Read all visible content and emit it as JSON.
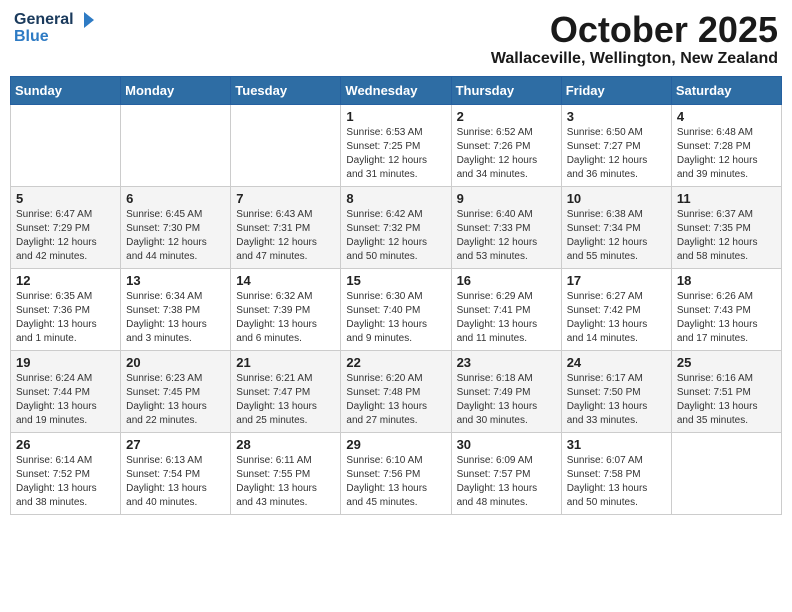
{
  "header": {
    "logo_line1": "General",
    "logo_line2": "Blue",
    "month": "October 2025",
    "location": "Wallaceville, Wellington, New Zealand"
  },
  "weekdays": [
    "Sunday",
    "Monday",
    "Tuesday",
    "Wednesday",
    "Thursday",
    "Friday",
    "Saturday"
  ],
  "weeks": [
    [
      {
        "day": "",
        "info": ""
      },
      {
        "day": "",
        "info": ""
      },
      {
        "day": "",
        "info": ""
      },
      {
        "day": "1",
        "info": "Sunrise: 6:53 AM\nSunset: 7:25 PM\nDaylight: 12 hours\nand 31 minutes."
      },
      {
        "day": "2",
        "info": "Sunrise: 6:52 AM\nSunset: 7:26 PM\nDaylight: 12 hours\nand 34 minutes."
      },
      {
        "day": "3",
        "info": "Sunrise: 6:50 AM\nSunset: 7:27 PM\nDaylight: 12 hours\nand 36 minutes."
      },
      {
        "day": "4",
        "info": "Sunrise: 6:48 AM\nSunset: 7:28 PM\nDaylight: 12 hours\nand 39 minutes."
      }
    ],
    [
      {
        "day": "5",
        "info": "Sunrise: 6:47 AM\nSunset: 7:29 PM\nDaylight: 12 hours\nand 42 minutes."
      },
      {
        "day": "6",
        "info": "Sunrise: 6:45 AM\nSunset: 7:30 PM\nDaylight: 12 hours\nand 44 minutes."
      },
      {
        "day": "7",
        "info": "Sunrise: 6:43 AM\nSunset: 7:31 PM\nDaylight: 12 hours\nand 47 minutes."
      },
      {
        "day": "8",
        "info": "Sunrise: 6:42 AM\nSunset: 7:32 PM\nDaylight: 12 hours\nand 50 minutes."
      },
      {
        "day": "9",
        "info": "Sunrise: 6:40 AM\nSunset: 7:33 PM\nDaylight: 12 hours\nand 53 minutes."
      },
      {
        "day": "10",
        "info": "Sunrise: 6:38 AM\nSunset: 7:34 PM\nDaylight: 12 hours\nand 55 minutes."
      },
      {
        "day": "11",
        "info": "Sunrise: 6:37 AM\nSunset: 7:35 PM\nDaylight: 12 hours\nand 58 minutes."
      }
    ],
    [
      {
        "day": "12",
        "info": "Sunrise: 6:35 AM\nSunset: 7:36 PM\nDaylight: 13 hours\nand 1 minute."
      },
      {
        "day": "13",
        "info": "Sunrise: 6:34 AM\nSunset: 7:38 PM\nDaylight: 13 hours\nand 3 minutes."
      },
      {
        "day": "14",
        "info": "Sunrise: 6:32 AM\nSunset: 7:39 PM\nDaylight: 13 hours\nand 6 minutes."
      },
      {
        "day": "15",
        "info": "Sunrise: 6:30 AM\nSunset: 7:40 PM\nDaylight: 13 hours\nand 9 minutes."
      },
      {
        "day": "16",
        "info": "Sunrise: 6:29 AM\nSunset: 7:41 PM\nDaylight: 13 hours\nand 11 minutes."
      },
      {
        "day": "17",
        "info": "Sunrise: 6:27 AM\nSunset: 7:42 PM\nDaylight: 13 hours\nand 14 minutes."
      },
      {
        "day": "18",
        "info": "Sunrise: 6:26 AM\nSunset: 7:43 PM\nDaylight: 13 hours\nand 17 minutes."
      }
    ],
    [
      {
        "day": "19",
        "info": "Sunrise: 6:24 AM\nSunset: 7:44 PM\nDaylight: 13 hours\nand 19 minutes."
      },
      {
        "day": "20",
        "info": "Sunrise: 6:23 AM\nSunset: 7:45 PM\nDaylight: 13 hours\nand 22 minutes."
      },
      {
        "day": "21",
        "info": "Sunrise: 6:21 AM\nSunset: 7:47 PM\nDaylight: 13 hours\nand 25 minutes."
      },
      {
        "day": "22",
        "info": "Sunrise: 6:20 AM\nSunset: 7:48 PM\nDaylight: 13 hours\nand 27 minutes."
      },
      {
        "day": "23",
        "info": "Sunrise: 6:18 AM\nSunset: 7:49 PM\nDaylight: 13 hours\nand 30 minutes."
      },
      {
        "day": "24",
        "info": "Sunrise: 6:17 AM\nSunset: 7:50 PM\nDaylight: 13 hours\nand 33 minutes."
      },
      {
        "day": "25",
        "info": "Sunrise: 6:16 AM\nSunset: 7:51 PM\nDaylight: 13 hours\nand 35 minutes."
      }
    ],
    [
      {
        "day": "26",
        "info": "Sunrise: 6:14 AM\nSunset: 7:52 PM\nDaylight: 13 hours\nand 38 minutes."
      },
      {
        "day": "27",
        "info": "Sunrise: 6:13 AM\nSunset: 7:54 PM\nDaylight: 13 hours\nand 40 minutes."
      },
      {
        "day": "28",
        "info": "Sunrise: 6:11 AM\nSunset: 7:55 PM\nDaylight: 13 hours\nand 43 minutes."
      },
      {
        "day": "29",
        "info": "Sunrise: 6:10 AM\nSunset: 7:56 PM\nDaylight: 13 hours\nand 45 minutes."
      },
      {
        "day": "30",
        "info": "Sunrise: 6:09 AM\nSunset: 7:57 PM\nDaylight: 13 hours\nand 48 minutes."
      },
      {
        "day": "31",
        "info": "Sunrise: 6:07 AM\nSunset: 7:58 PM\nDaylight: 13 hours\nand 50 minutes."
      },
      {
        "day": "",
        "info": ""
      }
    ]
  ]
}
